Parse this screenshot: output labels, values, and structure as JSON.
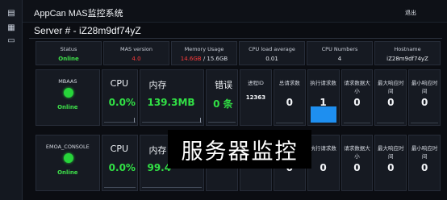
{
  "app": {
    "title": "AppCan MAS监控系统",
    "top_link": "退出"
  },
  "server": {
    "title": "Server # - iZ28m9df74yZ"
  },
  "info": [
    {
      "label": "Status",
      "value": "Online",
      "style": "green"
    },
    {
      "label": "MAS version",
      "value": "4.0",
      "style": "red"
    },
    {
      "label": "Memory Usage",
      "value_used": "14.6GB",
      "value_total": " / 15.6GB",
      "style": "mem"
    },
    {
      "label": "CPU load average",
      "value": "0.01",
      "style": "plain"
    },
    {
      "label": "CPU Numbers",
      "value": "4",
      "style": "plain"
    },
    {
      "label": "Hostname",
      "value": "iZ28m9df74yZ",
      "style": "plain"
    }
  ],
  "labels": {
    "cpu": "CPU",
    "mem": "内存",
    "err": "错误",
    "pid": "进程ID",
    "total": "总请求数",
    "running": "执行请求数",
    "size": "请求数据大小",
    "max_time": "最大响应时间",
    "min_time": "最小响应时间"
  },
  "servers": [
    {
      "name": "MBAAS",
      "status": "Online",
      "cpu": "0.0%",
      "mem": "139.3MB",
      "errors": "0 条",
      "pid": "12363",
      "total": "0",
      "running": "1",
      "size": "0",
      "max_time": "0",
      "min_time": "0",
      "running_bar_fill": 1.0
    },
    {
      "name": "EMOA_CONSOLE",
      "status": "Online",
      "cpu": "0.0%",
      "mem": "99.4",
      "errors": "",
      "pid": "",
      "total": "0",
      "running": "0",
      "size": "0",
      "max_time": "0",
      "min_time": "0",
      "running_bar_fill": 0
    }
  ],
  "overlay_text": "服务器监控",
  "colors": {
    "online": "#27d43a",
    "value_green": "#31e045",
    "accent_blue": "#1e8ff0",
    "version_red": "#ff3b3b"
  },
  "icons": [
    "server-icon",
    "monitor-icon",
    "document-icon"
  ]
}
